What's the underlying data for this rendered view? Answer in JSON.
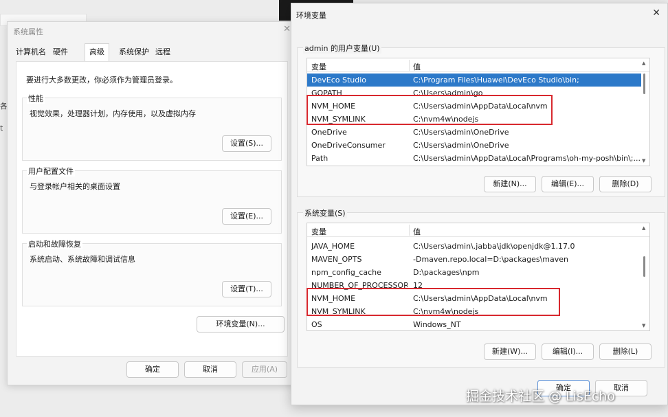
{
  "system_properties": {
    "title": "系统属性",
    "close_glyph": "✕",
    "tabs": [
      {
        "label": "计算机名"
      },
      {
        "label": "硬件"
      },
      {
        "label": "高级",
        "active": true
      },
      {
        "label": "系统保护"
      },
      {
        "label": "远程"
      }
    ],
    "admin_notice": "要进行大多数更改，你必须作为管理员登录。",
    "performance": {
      "label": "性能",
      "desc": "视觉效果，处理器计划，内存使用，以及虚拟内存",
      "button": "设置(S)..."
    },
    "user_profiles": {
      "label": "用户配置文件",
      "desc": "与登录帐户相关的桌面设置",
      "button": "设置(E)..."
    },
    "startup_recovery": {
      "label": "启动和故障恢复",
      "desc": "系统启动、系统故障和调试信息",
      "button": "设置(T)..."
    },
    "env_button": "环境变量(N)...",
    "ok": "确定",
    "cancel": "取消",
    "apply": "应用(A)"
  },
  "environment_variables": {
    "title": "环境变量",
    "close_glyph": "✕",
    "user_section": {
      "label": "admin 的用户变量(U)",
      "col_name": "变量",
      "col_value": "值",
      "rows": [
        {
          "name": "DevEco Studio",
          "value": "C:\\Program Files\\Huawei\\DevEco Studio\\bin;",
          "selected": true
        },
        {
          "name": "GOPATH",
          "value": "C:\\Users\\admin\\go"
        },
        {
          "name": "NVM_HOME",
          "value": "C:\\Users\\admin\\AppData\\Local\\nvm"
        },
        {
          "name": "NVM_SYMLINK",
          "value": "C:\\nvm4w\\nodejs"
        },
        {
          "name": "OneDrive",
          "value": "C:\\Users\\admin\\OneDrive"
        },
        {
          "name": "OneDriveConsumer",
          "value": "C:\\Users\\admin\\OneDrive"
        },
        {
          "name": "Path",
          "value": "C:\\Users\\admin\\AppData\\Local\\Programs\\oh-my-posh\\bin\\;..."
        }
      ],
      "new_button": "新建(N)...",
      "edit_button": "编辑(E)...",
      "delete_button": "删除(D)"
    },
    "system_section": {
      "label": "系统变量(S)",
      "col_name": "变量",
      "col_value": "值",
      "rows": [
        {
          "name": "JAVA_HOME",
          "value": "C:\\Users\\admin\\.jabba\\jdk\\openjdk@1.17.0"
        },
        {
          "name": "MAVEN_OPTS",
          "value": "-Dmaven.repo.local=D:\\packages\\maven"
        },
        {
          "name": "npm_config_cache",
          "value": "D:\\packages\\npm"
        },
        {
          "name": "NUMBER_OF_PROCESSORS",
          "value": "12"
        },
        {
          "name": "NVM_HOME",
          "value": "C:\\Users\\admin\\AppData\\Local\\nvm"
        },
        {
          "name": "NVM_SYMLINK",
          "value": "C:\\nvm4w\\nodejs"
        },
        {
          "name": "OS",
          "value": "Windows_NT"
        }
      ],
      "new_button": "新建(W)...",
      "edit_button": "编辑(I)...",
      "delete_button": "删除(L)"
    },
    "ok": "确定",
    "cancel": "取消"
  },
  "watermark": "掘金技术社区 @ LisEcho",
  "colors": {
    "selection": "#2c79c9",
    "highlight_box": "#d8282e"
  }
}
